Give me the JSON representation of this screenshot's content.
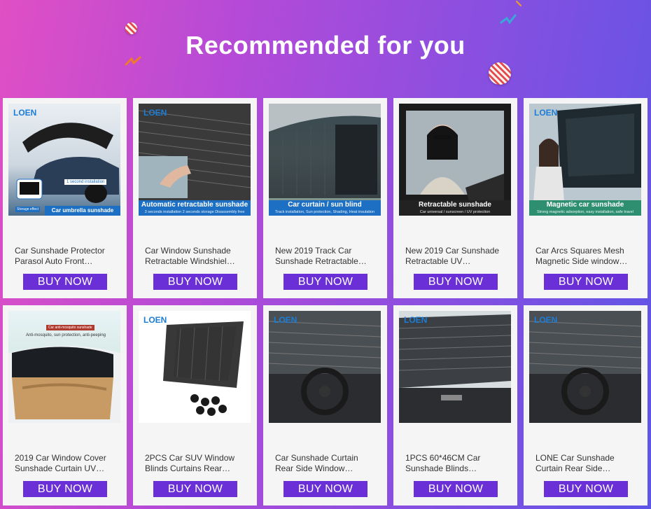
{
  "header": {
    "title": "Recommended for you"
  },
  "colors": {
    "accent": "#6a2fd6",
    "background_start": "#e04fc4",
    "background_end": "#5d55e6"
  },
  "buy_label": "BUY NOW",
  "products": [
    {
      "line1": "Car Sunshade Protector",
      "line2": "Parasol Auto Front…",
      "logo": "LOEN",
      "banner_title": "Car umbrella sunshade",
      "banner_sub": "",
      "badge": "1 second installation",
      "badge2": "Storage effect"
    },
    {
      "line1": "Car Window Sunshade",
      "line2": "Retractable Windshiel…",
      "logo": "LOEN",
      "banner_title": "Automatic retractable sunshade",
      "banner_sub": "3 seconds installation 2 seconds storage Disassembly free"
    },
    {
      "line1": "New 2019 Track Car",
      "line2": "Sunshade Retractable…",
      "logo": "",
      "banner_title": "Car curtain / sun blind",
      "banner_sub": "Track installation, Sun protection, Shading, Heat insulation"
    },
    {
      "line1": "New 2019 Car Sunshade",
      "line2": "Retractable UV…",
      "logo": "",
      "banner_title": "Retractable sunshade",
      "banner_sub": "Car universal / sunscreen / UV protection"
    },
    {
      "line1": "Car Arcs Squares Mesh",
      "line2": "Magnetic Side window…",
      "logo": "LOEN",
      "banner_title": "Magnetic car sunshade",
      "banner_sub": "Strong magnetic adsorption, easy installation, safe travel"
    },
    {
      "line1": "2019 Car Window Cover",
      "line2": "Sunshade Curtain UV…",
      "logo": "",
      "banner_title": "",
      "banner_sub": "",
      "top_label": "Car anti-mosquito sunshade",
      "top_text": "Anti-mosquito, sun protection, anti-peeping"
    },
    {
      "line1": "2PCS Car SUV Window",
      "line2": "Blinds Curtains Rear…",
      "logo": "LOEN",
      "banner_title": "",
      "banner_sub": ""
    },
    {
      "line1": "Car Sunshade Curtain",
      "line2": "Rear Side Window…",
      "logo": "LOEN",
      "banner_title": "",
      "banner_sub": ""
    },
    {
      "line1": "1PCS 60*46CM Car",
      "line2": "Sunshade Blinds…",
      "logo": "LOEN",
      "banner_title": "",
      "banner_sub": ""
    },
    {
      "line1": "LONE Car Sunshade",
      "line2": "Curtain Rear Side…",
      "logo": "LOEN",
      "banner_title": "",
      "banner_sub": ""
    }
  ]
}
